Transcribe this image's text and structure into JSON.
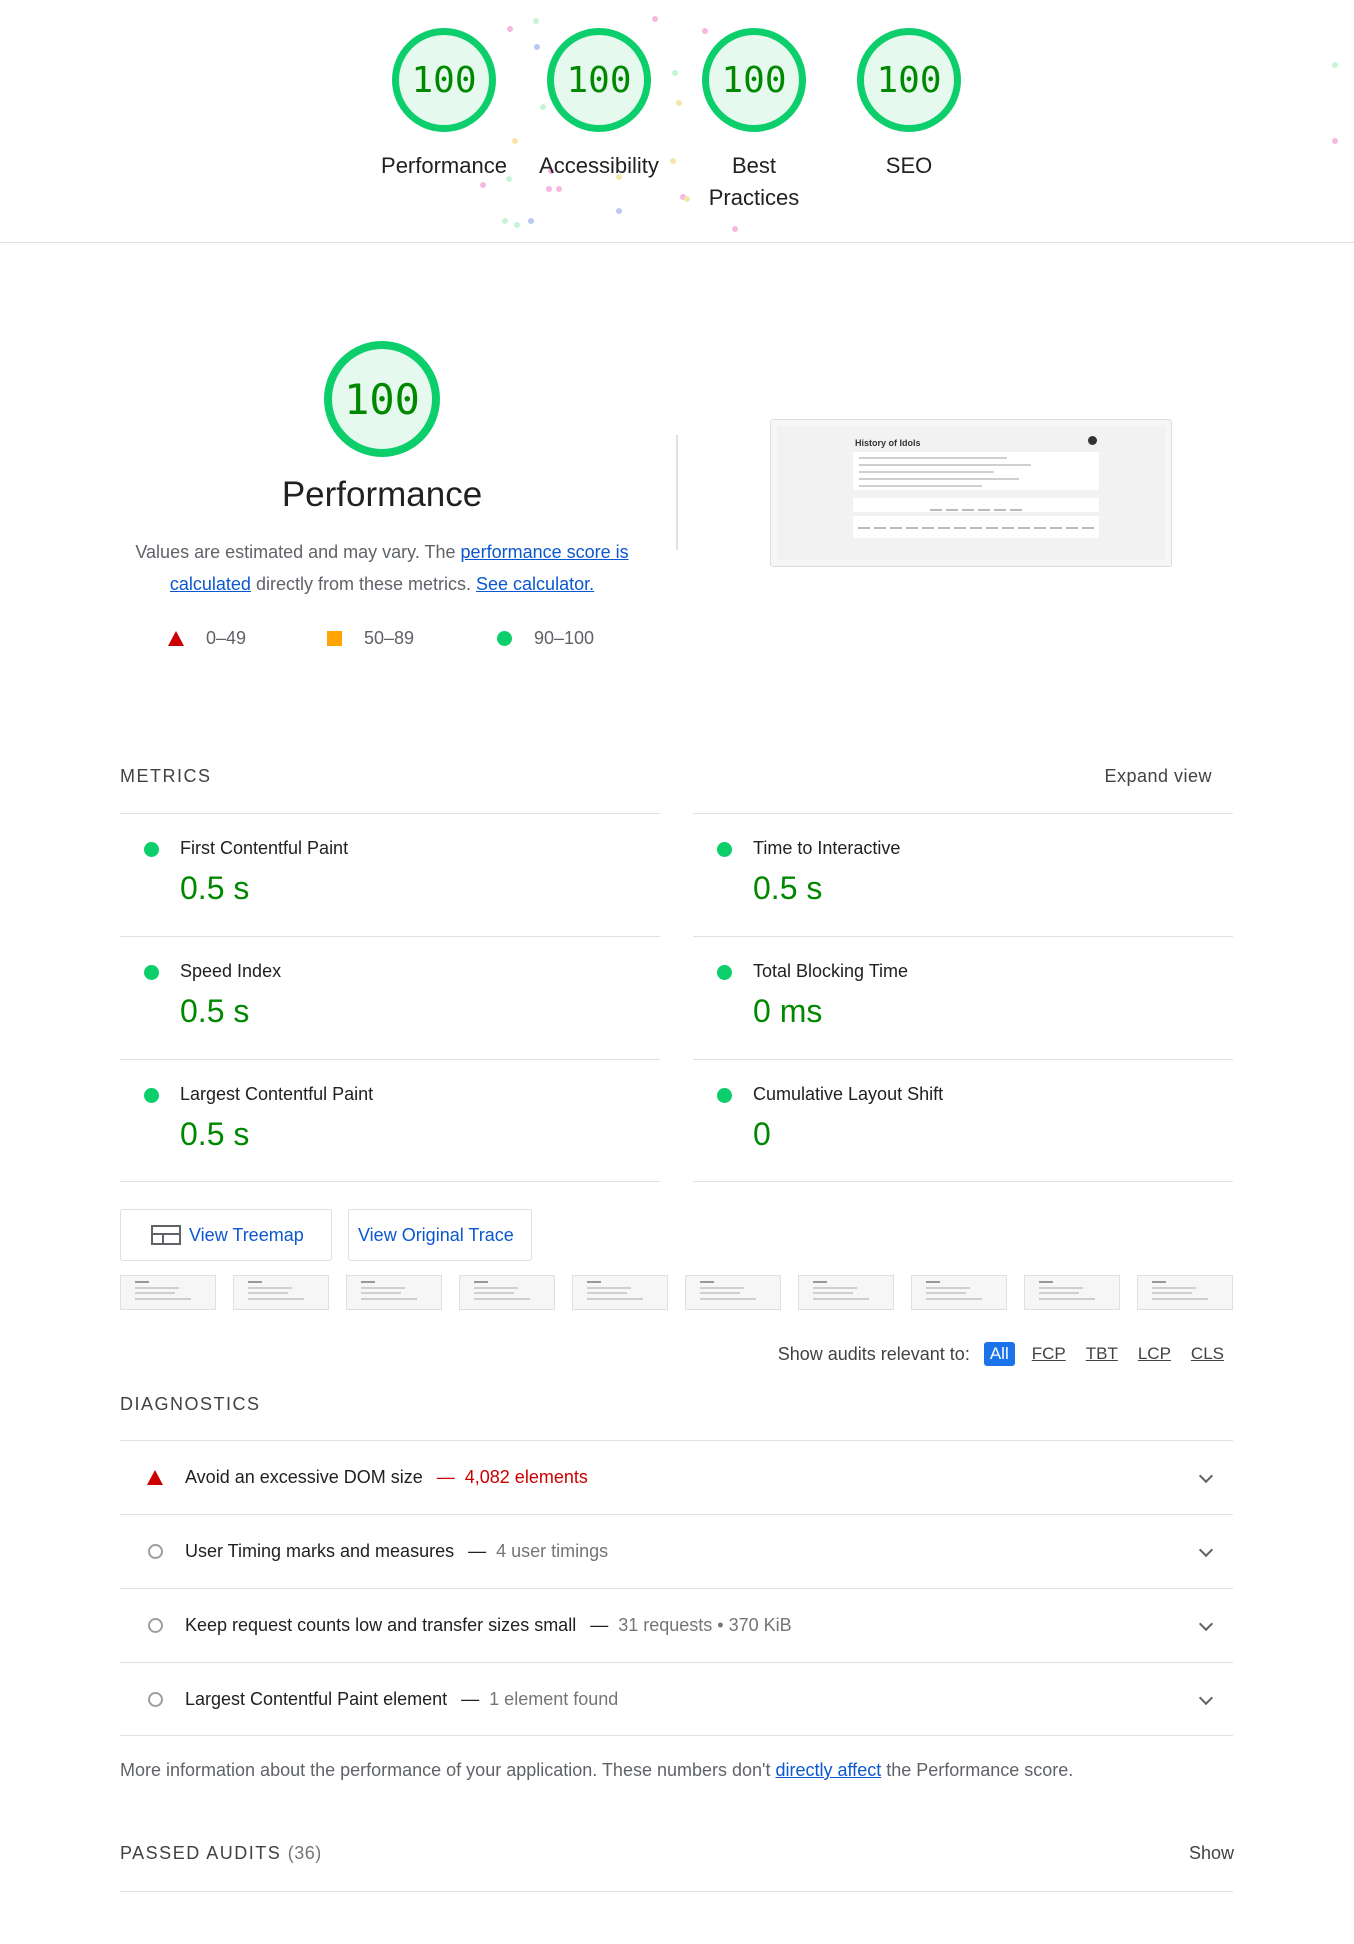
{
  "categories": [
    {
      "score": "100",
      "label": "Performance"
    },
    {
      "score": "100",
      "label": "Accessibility"
    },
    {
      "score": "100",
      "label": "Best Practices"
    },
    {
      "score": "100",
      "label": "SEO"
    }
  ],
  "performance": {
    "score": "100",
    "title": "Performance",
    "desc_text_1": "Values are estimated and may vary. The ",
    "desc_link_1": "performance score is calculated",
    "desc_text_2": " directly from these metrics. ",
    "desc_link_2": "See calculator.",
    "legend": {
      "fail": "0–49",
      "average": "50–89",
      "pass": "90–100"
    },
    "screenshot_title": "History of Idols"
  },
  "metrics": {
    "title": "METRICS",
    "expand": "Expand view",
    "items": [
      {
        "name": "First Contentful Paint",
        "value": "0.5 s"
      },
      {
        "name": "Time to Interactive",
        "value": "0.5 s"
      },
      {
        "name": "Speed Index",
        "value": "0.5 s"
      },
      {
        "name": "Total Blocking Time",
        "value": "0 ms"
      },
      {
        "name": "Largest Contentful Paint",
        "value": "0.5 s"
      },
      {
        "name": "Cumulative Layout Shift",
        "value": "0"
      }
    ]
  },
  "buttons": {
    "treemap": "View Treemap",
    "trace": "View Original Trace"
  },
  "filter": {
    "label": "Show audits relevant to:",
    "chips": [
      "All",
      "FCP",
      "TBT",
      "LCP",
      "CLS"
    ]
  },
  "diagnostics": {
    "title": "DIAGNOSTICS",
    "items": [
      {
        "title": "Avoid an excessive DOM size",
        "display": "4,082 elements"
      },
      {
        "title": "User Timing marks and measures",
        "display": "4 user timings"
      },
      {
        "title": "Keep request counts low and transfer sizes small",
        "display": "31 requests • 370 KiB"
      },
      {
        "title": "Largest Contentful Paint element",
        "display": "1 element found"
      }
    ],
    "dash": "—",
    "note_text_1": "More information about the performance of your application. These numbers don't ",
    "note_link": "directly affect",
    "note_text_2": " the Performance score."
  },
  "passed": {
    "title": "PASSED AUDITS",
    "count": "(36)",
    "show": "Show"
  },
  "colors": {
    "pass": "#0cce6b",
    "pass_text": "#008800",
    "fail": "#cc0000",
    "average": "#ffa400",
    "link": "#0b57d0"
  }
}
